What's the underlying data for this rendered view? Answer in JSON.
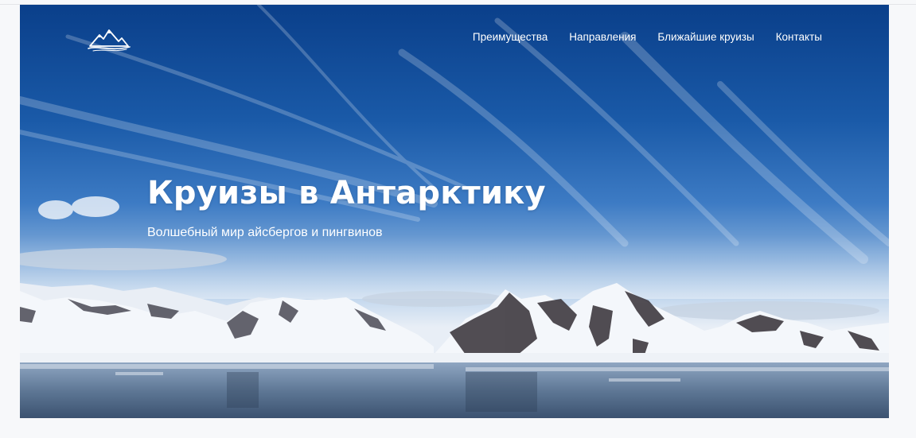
{
  "nav": {
    "items": [
      {
        "label": "Преимущества"
      },
      {
        "label": "Направления"
      },
      {
        "label": "Ближайшие круизы"
      },
      {
        "label": "Контакты"
      }
    ]
  },
  "hero": {
    "title": "Круизы в Антарктику",
    "subtitle": "Волшебный мир айсбергов и пингвинов",
    "background_image": "antarctic-mountains-photo"
  },
  "logo": {
    "icon": "mountain-logo-icon"
  },
  "colors": {
    "sky_top": "#0a3f8a",
    "sky_mid": "#3d7bc4",
    "snow": "#f4f7fb",
    "text": "#ffffff",
    "page_bg": "#f7f8fa"
  }
}
